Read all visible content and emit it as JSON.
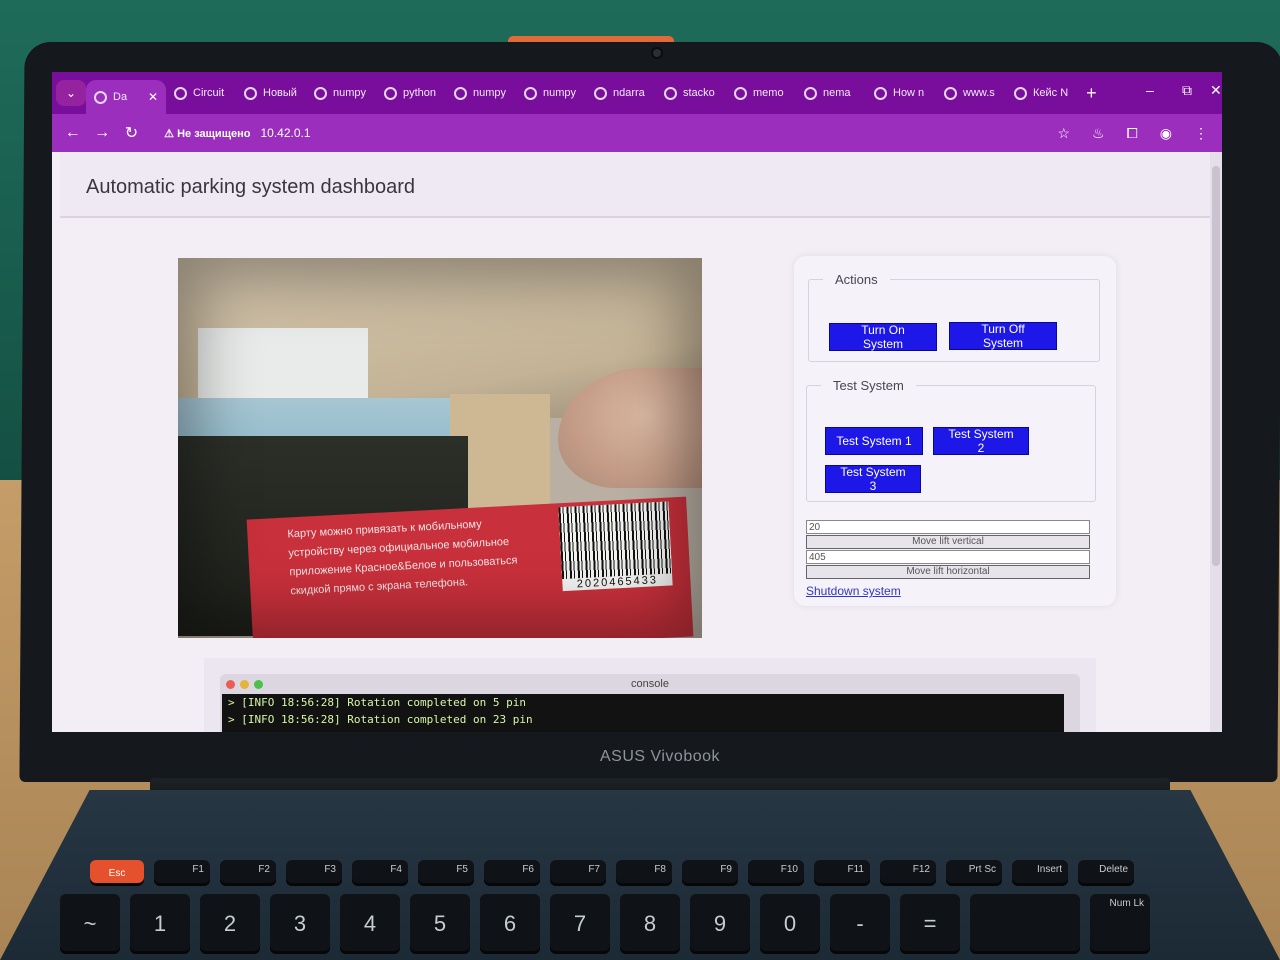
{
  "device": {
    "brand": "ASUS Vivobook"
  },
  "browser": {
    "tabs": [
      {
        "label": "Da",
        "active": true
      },
      {
        "label": "Circuit"
      },
      {
        "label": "Новый"
      },
      {
        "label": "numpy"
      },
      {
        "label": "python"
      },
      {
        "label": "numpy"
      },
      {
        "label": "numpy"
      },
      {
        "label": "ndarra"
      },
      {
        "label": "stacko"
      },
      {
        "label": "memo"
      },
      {
        "label": "nema"
      },
      {
        "label": "How n"
      },
      {
        "label": "www.s"
      },
      {
        "label": "Кейс N"
      }
    ],
    "new_tab": "+",
    "controls": {
      "minimize": "–",
      "restore": "⧉",
      "close": "✕"
    },
    "nav": {
      "back": "←",
      "forward": "→",
      "reload": "↻"
    },
    "security_label": "Не защищено",
    "url": "10.42.0.1",
    "accent_color": "#7a0e9c"
  },
  "page": {
    "title": "Automatic parking system dashboard",
    "camera_feed": {
      "card_text": "Карту можно привязать к мобильному устройству через официальное мобильное приложение Красное&Белое и пользоваться скидкой прямо с экрана телефона.",
      "barcode_number": "2020465433"
    },
    "actions": {
      "legend": "Actions",
      "turn_on": "Turn On System",
      "turn_off": "Turn Off System"
    },
    "test_system": {
      "legend": "Test System",
      "test1": "Test System 1",
      "test2": "Test System 2",
      "test3": "Test System 3"
    },
    "lift": {
      "vertical_value": "20",
      "vertical_button": "Move lift vertical",
      "horizontal_value": "405",
      "horizontal_button": "Move lift horizontal"
    },
    "shutdown_link": "Shutdown system",
    "console": {
      "title": "console",
      "lines": [
        "> [INFO 18:56:28] Rotation completed on 5 pin",
        "> [INFO 18:56:28] Rotation completed on 23 pin"
      ]
    },
    "button_color": "#1d18e8"
  },
  "keyboard": {
    "fn_row": [
      "Esc",
      "F1",
      "F2",
      "F3",
      "F4",
      "F5",
      "F6",
      "F7",
      "F8",
      "F9",
      "F10",
      "F11",
      "F12",
      "Prt Sc",
      "Insert",
      "Delete"
    ],
    "num_row": [
      "~",
      "1",
      "2",
      "3",
      "4",
      "5",
      "6",
      "7",
      "8",
      "9",
      "0",
      "-",
      "=",
      "",
      "Num Lk"
    ]
  }
}
